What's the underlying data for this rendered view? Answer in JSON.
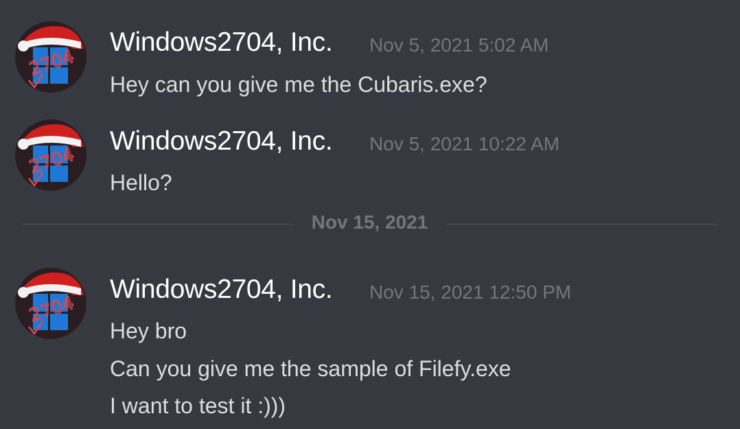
{
  "messages": [
    {
      "author": "Windows2704, Inc.",
      "timestamp": "Nov 5, 2021 5:02 AM",
      "lines": [
        "Hey can you give me the Cubaris.exe?"
      ],
      "avatar_icon": "windows-logo-santa-hat-avatar-icon"
    },
    {
      "author": "Windows2704, Inc.",
      "timestamp": "Nov 5, 2021 10:22 AM",
      "lines": [
        "Hello?"
      ],
      "avatar_icon": "windows-logo-santa-hat-avatar-icon"
    },
    {
      "author": "Windows2704, Inc.",
      "timestamp": "Nov 15, 2021 12:50 PM",
      "lines": [
        "Hey bro",
        "Can you give me the sample of Filefy.exe",
        "I want to test it :)))"
      ],
      "avatar_icon": "windows-logo-santa-hat-avatar-icon"
    }
  ],
  "date_divider": {
    "label": "Nov 15, 2021"
  },
  "avatar_text": "2704",
  "colors": {
    "background": "#36393f",
    "username": "#ffffff",
    "timestamp": "#72767d",
    "message_text": "#dcddde",
    "divider": "#4f545c",
    "avatar_bg": "#2a1d22",
    "windows_blue": "#1e78d6",
    "santa_red": "#d01f1f",
    "avatar_scribble": "#e0464d"
  }
}
